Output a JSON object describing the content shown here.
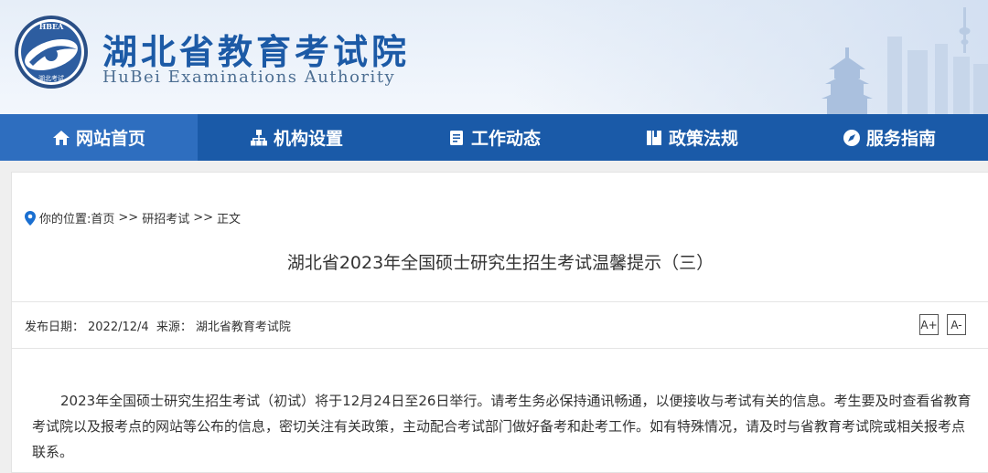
{
  "header": {
    "emblem_text": "HBEA",
    "emblem_caption": "湖北考试",
    "title": "湖北省教育考试院",
    "subtitle": "HuBei Examinations Authority"
  },
  "nav": {
    "items": [
      {
        "label": "网站首页",
        "icon": "home-icon",
        "active": true
      },
      {
        "label": "机构设置",
        "icon": "org-chart-icon",
        "active": false
      },
      {
        "label": "工作动态",
        "icon": "document-icon",
        "active": false
      },
      {
        "label": "政策法规",
        "icon": "book-icon",
        "active": false
      },
      {
        "label": "服务指南",
        "icon": "compass-icon",
        "active": false
      }
    ]
  },
  "breadcrumb": {
    "prefix": "你的位置:",
    "items": [
      "首页",
      "研招考试",
      "正文"
    ],
    "separator": ">>"
  },
  "article": {
    "title": "湖北省2023年全国硕士研究生招生考试温馨提示（三）",
    "meta": {
      "date_label": "发布日期：",
      "date": "2022/12/4",
      "source_label": "来源：",
      "source": "湖北省教育考试院"
    },
    "font_increase": "A+",
    "font_decrease": "A-",
    "body": "2023年全国硕士研究生招生考试（初试）将于12月24日至26日举行。请考生务必保持通讯畅通，以便接收与考试有关的信息。考生要及时查看省教育考试院以及报考点的网站等公布的信息，密切关注有关政策，主动配合考试部门做好备考和赴考工作。如有特殊情况，请及时与省教育考试院或相关报考点联系。"
  },
  "colors": {
    "nav_bg": "#1a5aa8",
    "nav_active_bg": "#2e6ebf",
    "title_blue": "#1c5aa6",
    "location_pin": "#1a6fd1"
  }
}
